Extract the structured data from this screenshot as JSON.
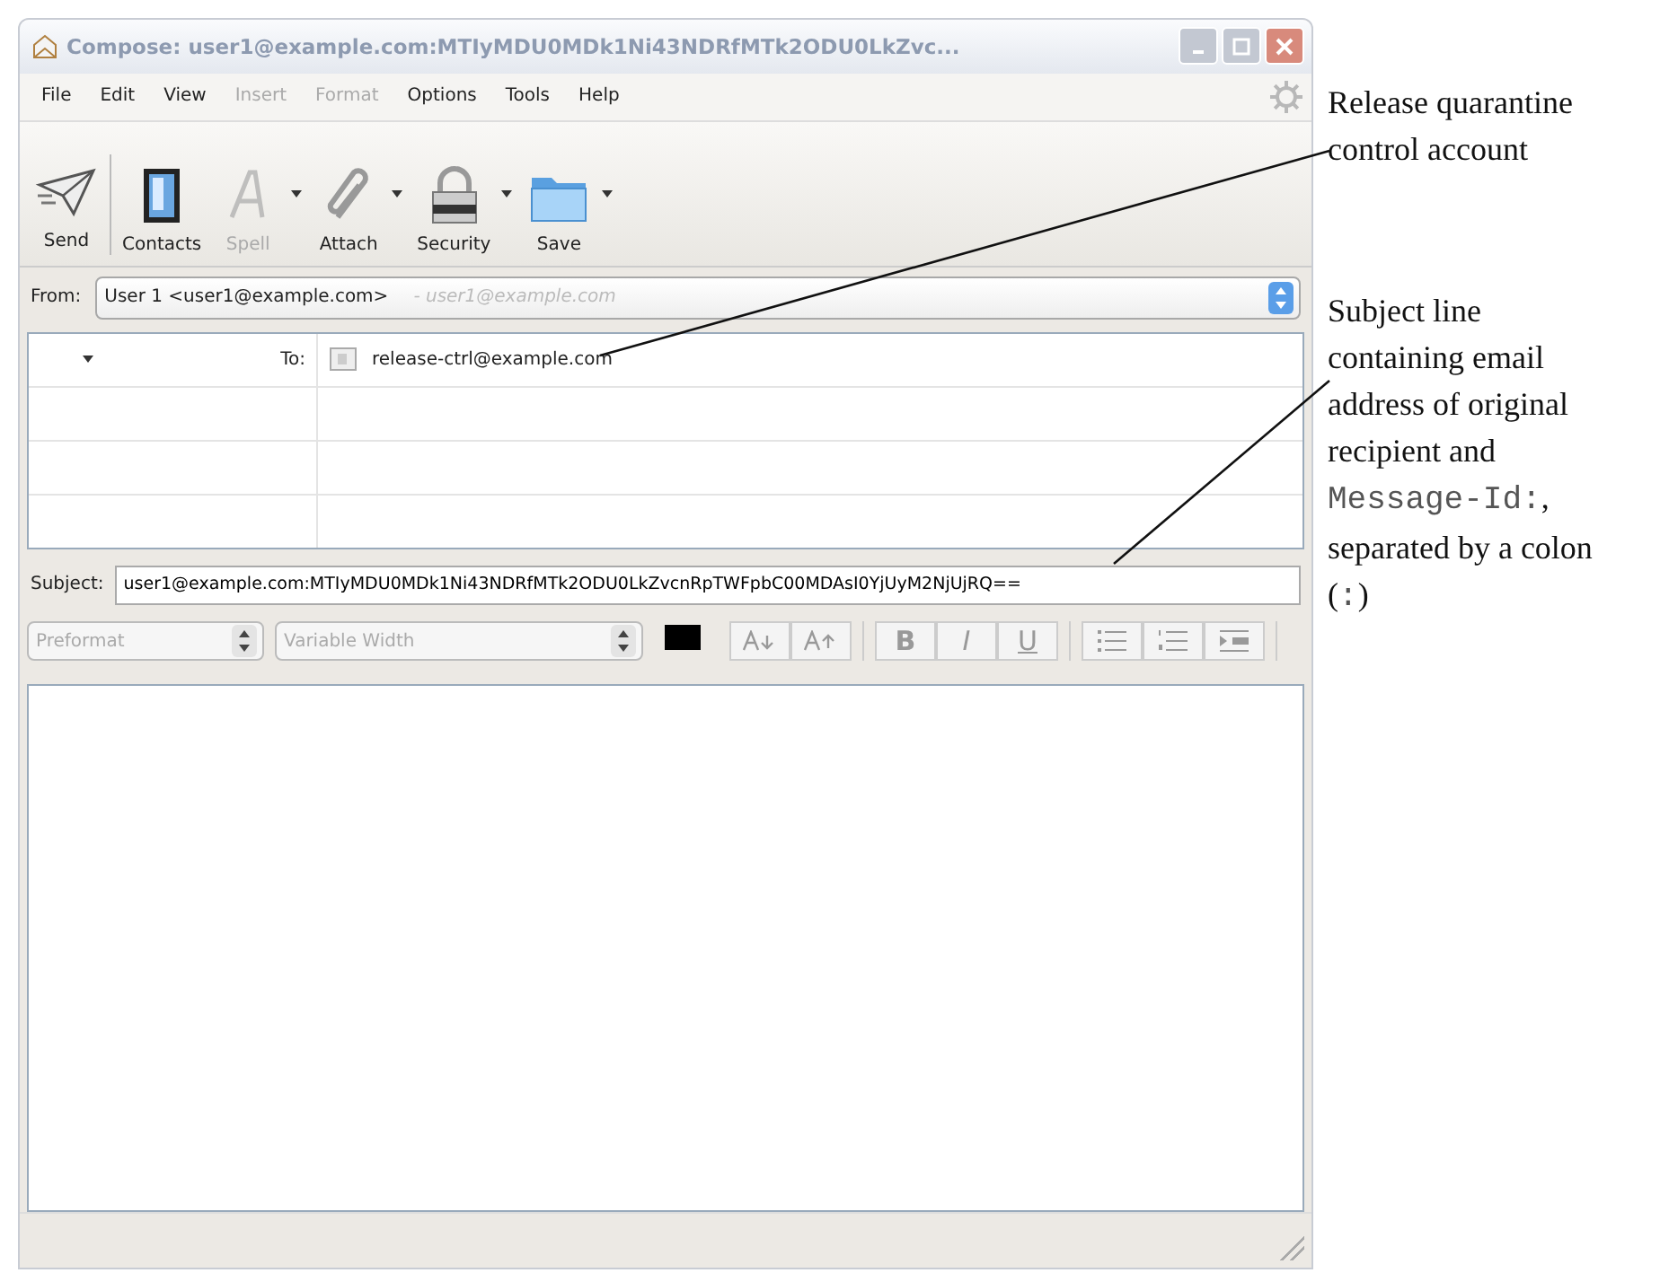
{
  "window": {
    "title": "Compose: user1@example.com:MTIyMDU0MDk1Ni43NDRfMTk2ODU0LkZvc..."
  },
  "menu": [
    {
      "label": "File",
      "disabled": false
    },
    {
      "label": "Edit",
      "disabled": false
    },
    {
      "label": "View",
      "disabled": false
    },
    {
      "label": "Insert",
      "disabled": true
    },
    {
      "label": "Format",
      "disabled": true
    },
    {
      "label": "Options",
      "disabled": false
    },
    {
      "label": "Tools",
      "disabled": false
    },
    {
      "label": "Help",
      "disabled": false
    }
  ],
  "toolbar": [
    {
      "kind": "send",
      "label": "Send",
      "disabled": false,
      "dropdown": false
    },
    {
      "kind": "contacts",
      "label": "Contacts",
      "disabled": false,
      "dropdown": false
    },
    {
      "kind": "spell",
      "label": "Spell",
      "disabled": true,
      "dropdown": true
    },
    {
      "kind": "attach",
      "label": "Attach",
      "disabled": false,
      "dropdown": true
    },
    {
      "kind": "security",
      "label": "Security",
      "disabled": false,
      "dropdown": true
    },
    {
      "kind": "save",
      "label": "Save",
      "disabled": false,
      "dropdown": true
    }
  ],
  "from": {
    "label": "From:",
    "value": "User 1 <user1@example.com>",
    "hint": "- user1@example.com"
  },
  "recipients": [
    {
      "type": "To:",
      "address": "release-ctrl@example.com"
    }
  ],
  "subject": {
    "label": "Subject:",
    "value": "user1@example.com:MTIyMDU0MDk1Ni43NDRfMTk2ODU0LkZvcnRpTWFpbC00MDAsI0YjUyM2NjUjRQ=="
  },
  "format_bar": {
    "paragraph": "Preformat",
    "font": "Variable Width",
    "bold": "B",
    "italic": "I",
    "underline": "U"
  },
  "annotations": [
    {
      "parts": [
        {
          "kind": "text",
          "text": "Release quarantine control account"
        }
      ]
    },
    {
      "parts": [
        {
          "kind": "text",
          "text": "Subject line containing email address of original recipient and "
        },
        {
          "kind": "code",
          "text": "Message-Id:"
        },
        {
          "kind": "text",
          "text": ", separated by a colon ("
        },
        {
          "kind": "code",
          "text": ":"
        },
        {
          "kind": "text",
          "text": ")"
        }
      ]
    }
  ]
}
